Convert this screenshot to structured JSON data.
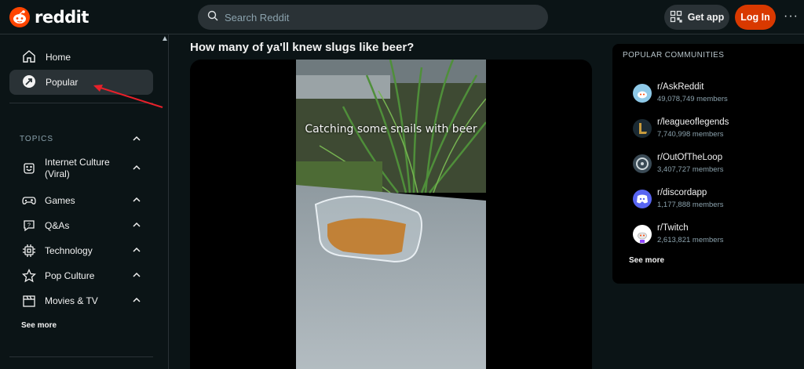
{
  "header": {
    "brand": "reddit",
    "search_placeholder": "Search Reddit",
    "get_app_label": "Get app",
    "login_label": "Log In",
    "more_label": "···"
  },
  "sidebar": {
    "nav": [
      {
        "label": "Home",
        "icon": "home-icon"
      },
      {
        "label": "Popular",
        "icon": "popular-icon",
        "active": true
      }
    ],
    "topics_title": "TOPICS",
    "topics": [
      {
        "label": "Internet Culture (Viral)",
        "icon": "smile-icon"
      },
      {
        "label": "Games",
        "icon": "gamepad-icon"
      },
      {
        "label": "Q&As",
        "icon": "qa-icon"
      },
      {
        "label": "Technology",
        "icon": "chip-icon"
      },
      {
        "label": "Pop Culture",
        "icon": "star-icon"
      },
      {
        "label": "Movies & TV",
        "icon": "clapper-icon"
      }
    ],
    "see_more": "See more"
  },
  "post": {
    "title": "How many of ya'll knew slugs like beer?",
    "caption": "Catching some snails with beer"
  },
  "popular_communities": {
    "title": "POPULAR COMMUNITIES",
    "items": [
      {
        "name": "r/AskReddit",
        "members": "49,078,749 members",
        "color": "#8ec9e8"
      },
      {
        "name": "r/leagueoflegends",
        "members": "7,740,998 members",
        "color": "#1b2a33"
      },
      {
        "name": "r/OutOfTheLoop",
        "members": "3,407,727 members",
        "color": "#3a4a55"
      },
      {
        "name": "r/discordapp",
        "members": "1,177,888 members",
        "color": "#5865f2"
      },
      {
        "name": "r/Twitch",
        "members": "2,613,821 members",
        "color": "#ffffff"
      }
    ],
    "see_more": "See more"
  },
  "colors": {
    "background": "#0b1416",
    "accent": "#ff4500",
    "login": "#d93900",
    "annotation_arrow": "#e8202a"
  }
}
